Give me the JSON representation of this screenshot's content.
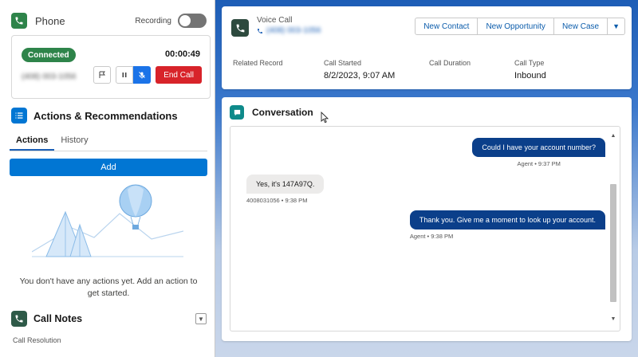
{
  "phone": {
    "title": "Phone",
    "recording_label": "Recording",
    "status": "Connected",
    "timer": "00:00:49",
    "caller_number": "(408) 003-1056",
    "end_call_label": "End Call"
  },
  "actions": {
    "title": "Actions & Recommendations",
    "tabs": [
      "Actions",
      "History"
    ],
    "add_label": "Add",
    "empty_text": "You don't have any actions yet. Add an action to get started."
  },
  "call_notes": {
    "title": "Call Notes",
    "field_label": "Call Resolution"
  },
  "voice_call": {
    "label": "Voice Call",
    "number": "(408) 003-1056",
    "buttons": [
      "New Contact",
      "New Opportunity",
      "New Case"
    ],
    "fields": [
      {
        "label": "Related Record",
        "value": ""
      },
      {
        "label": "Call Started",
        "value": "8/2/2023, 9:07 AM"
      },
      {
        "label": "Call Duration",
        "value": ""
      },
      {
        "label": "Call Type",
        "value": "Inbound"
      }
    ]
  },
  "conversation": {
    "title": "Conversation",
    "messages": [
      {
        "direction": "out",
        "text": "Could I have your account number?",
        "meta": "Agent • 9:37 PM"
      },
      {
        "direction": "in",
        "text": "Yes, it's 147A97Q.",
        "meta": "4008031056 • 9:38 PM"
      },
      {
        "direction": "out",
        "text": "Thank you. Give me a moment to look up your account.",
        "meta": "Agent • 9:38 PM"
      }
    ]
  },
  "colors": {
    "phone_icon": "#2e844a",
    "actions_icon": "#0176d3",
    "call_notes_icon": "#2e5a48",
    "conversation_icon": "#0e8a8a",
    "connected": "#2e844a",
    "end_call": "#d8232a",
    "add_button": "#0176d3",
    "agent_bubble": "#0b3f8a"
  },
  "icons": {
    "phone": "phone-icon",
    "actions": "list-icon",
    "notes": "phone-icon",
    "conversation": "chat-icon",
    "flag": "flag-icon",
    "pause": "pause-icon",
    "mute": "mute-icon"
  }
}
